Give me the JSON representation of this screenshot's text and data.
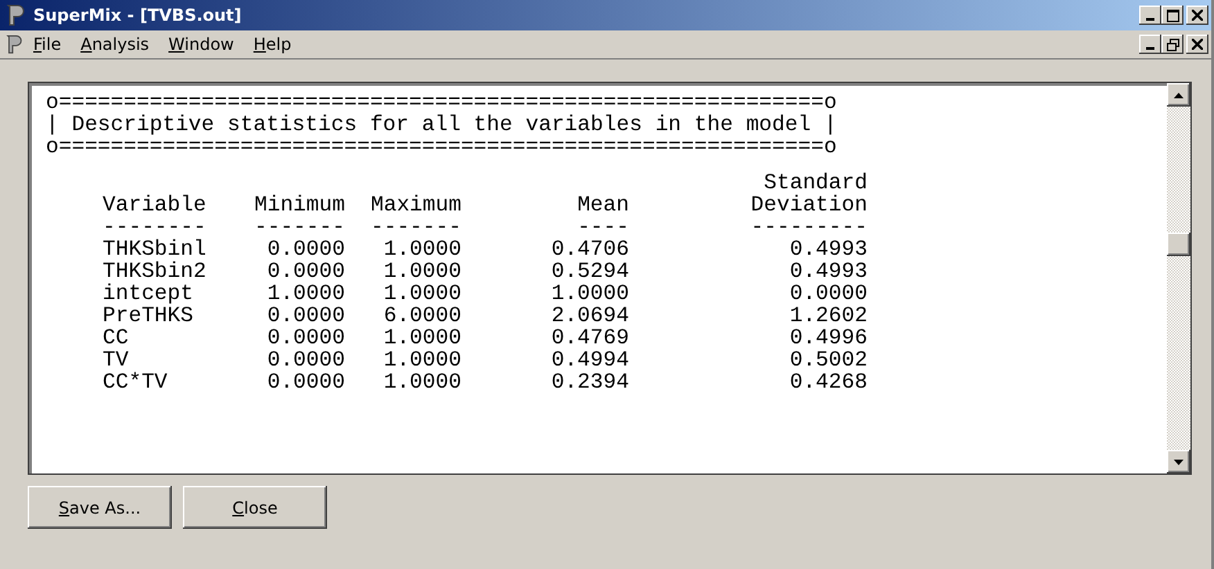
{
  "window": {
    "title": "SuperMix - [TVBS.out]"
  },
  "menu": [
    {
      "label": "File"
    },
    {
      "label": "Analysis"
    },
    {
      "label": "Window"
    },
    {
      "label": "Help"
    }
  ],
  "output": {
    "banner": [
      "o===========================================================o",
      "| Descriptive statistics for all the variables in the model |",
      "o===========================================================o"
    ],
    "columns": [
      {
        "heading": [
          "Variable"
        ],
        "rule": "--------"
      },
      {
        "heading": [
          "Minimum"
        ],
        "rule": "-------"
      },
      {
        "heading": [
          "Maximum"
        ],
        "rule": "-------"
      },
      {
        "heading": [
          "Mean"
        ],
        "rule": "----"
      },
      {
        "heading": [
          "Standard",
          "Deviation"
        ],
        "rule": "---------"
      }
    ],
    "rows": [
      [
        "THKSbinl",
        "0.0000",
        "1.0000",
        "0.4706",
        "0.4993"
      ],
      [
        "THKSbin2",
        "0.0000",
        "1.0000",
        "0.5294",
        "0.4993"
      ],
      [
        "intcept",
        "1.0000",
        "1.0000",
        "1.0000",
        "0.0000"
      ],
      [
        "PreTHKS",
        "0.0000",
        "6.0000",
        "2.0694",
        "1.2602"
      ],
      [
        "CC",
        "0.0000",
        "1.0000",
        "0.4769",
        "0.4996"
      ],
      [
        "TV",
        "0.0000",
        "1.0000",
        "0.4994",
        "0.5002"
      ],
      [
        "CC*TV",
        "0.0000",
        "1.0000",
        "0.2394",
        "0.4268"
      ]
    ]
  },
  "buttons": [
    {
      "label": "Save As..."
    },
    {
      "label": "Close"
    }
  ]
}
